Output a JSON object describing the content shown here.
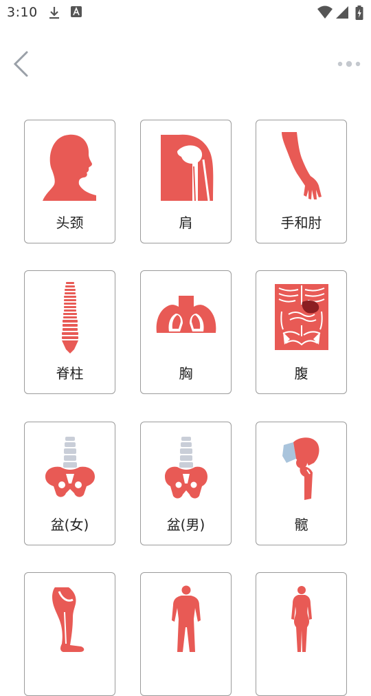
{
  "status_bar": {
    "time": "3:10",
    "icons": [
      "download-icon",
      "text-a-icon",
      "wifi-icon",
      "cell-signal-icon",
      "battery-charging-icon"
    ]
  },
  "toolbar": {
    "back_icon": "chevron-left-icon",
    "more_icon": "more-horizontal-icon"
  },
  "theme": {
    "accent": "#e85a55",
    "bone_gray": "#c9ced8",
    "card_border": "#9a9a9a"
  },
  "body_parts": [
    {
      "label": "头颈",
      "icon": "head-neck-icon"
    },
    {
      "label": "肩",
      "icon": "shoulder-icon"
    },
    {
      "label": "手和肘",
      "icon": "arm-icon"
    },
    {
      "label": "脊柱",
      "icon": "spine-icon"
    },
    {
      "label": "胸",
      "icon": "lungs-icon"
    },
    {
      "label": "腹",
      "icon": "abdomen-icon"
    },
    {
      "label": "盆(女)",
      "icon": "female-pelvis-icon"
    },
    {
      "label": "盆(男)",
      "icon": "male-pelvis-icon"
    },
    {
      "label": "髋",
      "icon": "hip-icon"
    },
    {
      "label": "",
      "icon": "knee-leg-icon"
    },
    {
      "label": "",
      "icon": "male-body-icon"
    },
    {
      "label": "",
      "icon": "female-body-icon"
    }
  ]
}
